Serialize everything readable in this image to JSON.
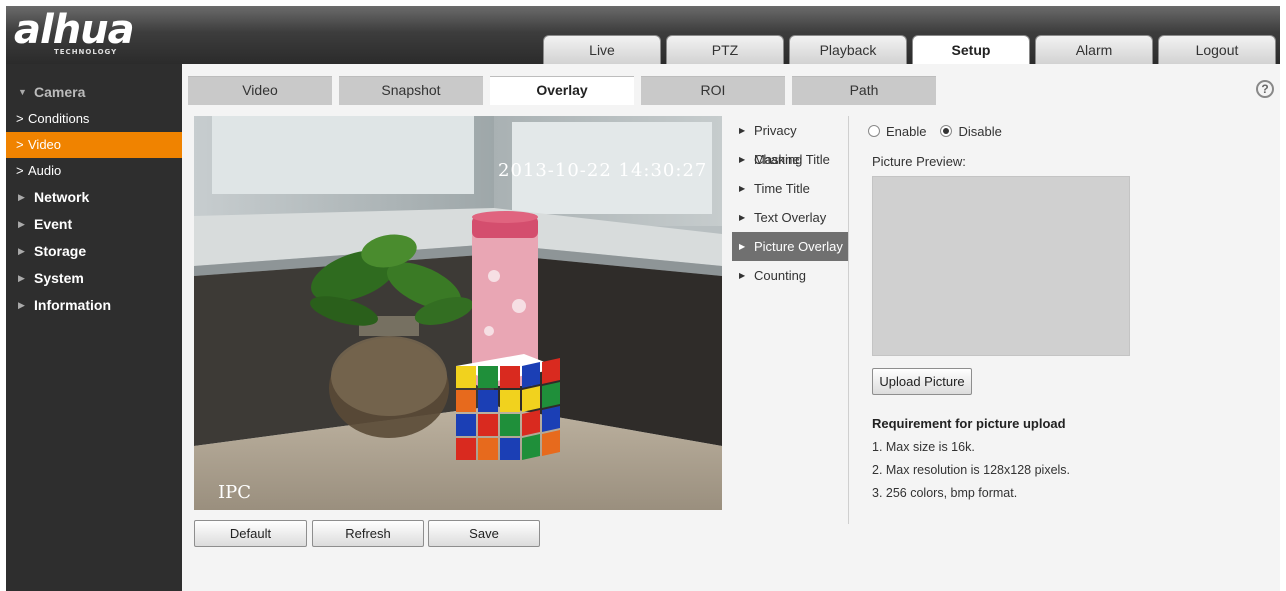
{
  "logo": {
    "main": "alhua",
    "sub": "TECHNOLOGY"
  },
  "top_tabs": [
    {
      "label": "Live",
      "active": false
    },
    {
      "label": "PTZ",
      "active": false
    },
    {
      "label": "Playback",
      "active": false
    },
    {
      "label": "Setup",
      "active": true
    },
    {
      "label": "Alarm",
      "active": false
    },
    {
      "label": "Logout",
      "active": false
    }
  ],
  "sidebar": {
    "camera": "Camera",
    "camera_items": [
      "Conditions",
      "Video",
      "Audio"
    ],
    "active_camera_item": "Video",
    "sections": [
      "Network",
      "Event",
      "Storage",
      "System",
      "Information"
    ]
  },
  "sub_tabs": [
    {
      "label": "Video",
      "active": false
    },
    {
      "label": "Snapshot",
      "active": false
    },
    {
      "label": "Overlay",
      "active": true
    },
    {
      "label": "ROI",
      "active": false
    },
    {
      "label": "Path",
      "active": false
    }
  ],
  "help": "?",
  "video": {
    "osd_time": "2013-10-22 14:30:27",
    "osd_channel": "IPC"
  },
  "buttons": {
    "default": "Default",
    "refresh": "Refresh",
    "save": "Save"
  },
  "overlay_menu": {
    "items": [
      "Privacy Masking",
      "Channel Title",
      "Time Title",
      "Text Overlay",
      "Picture Overlay",
      "Counting"
    ],
    "active": "Picture Overlay"
  },
  "settings": {
    "enable_label": "Enable",
    "disable_label": "Disable",
    "selected": "Disable",
    "preview_label": "Picture Preview:",
    "upload_button": "Upload Picture",
    "requirement_title": "Requirement for picture upload",
    "requirements": [
      "1. Max size is 16k.",
      "2. Max resolution is 128x128 pixels.",
      "3. 256 colors, bmp format."
    ]
  },
  "colors": {
    "accent": "#f08300",
    "sidebar_bg": "#2e2e2e",
    "menu_active": "#707070"
  }
}
